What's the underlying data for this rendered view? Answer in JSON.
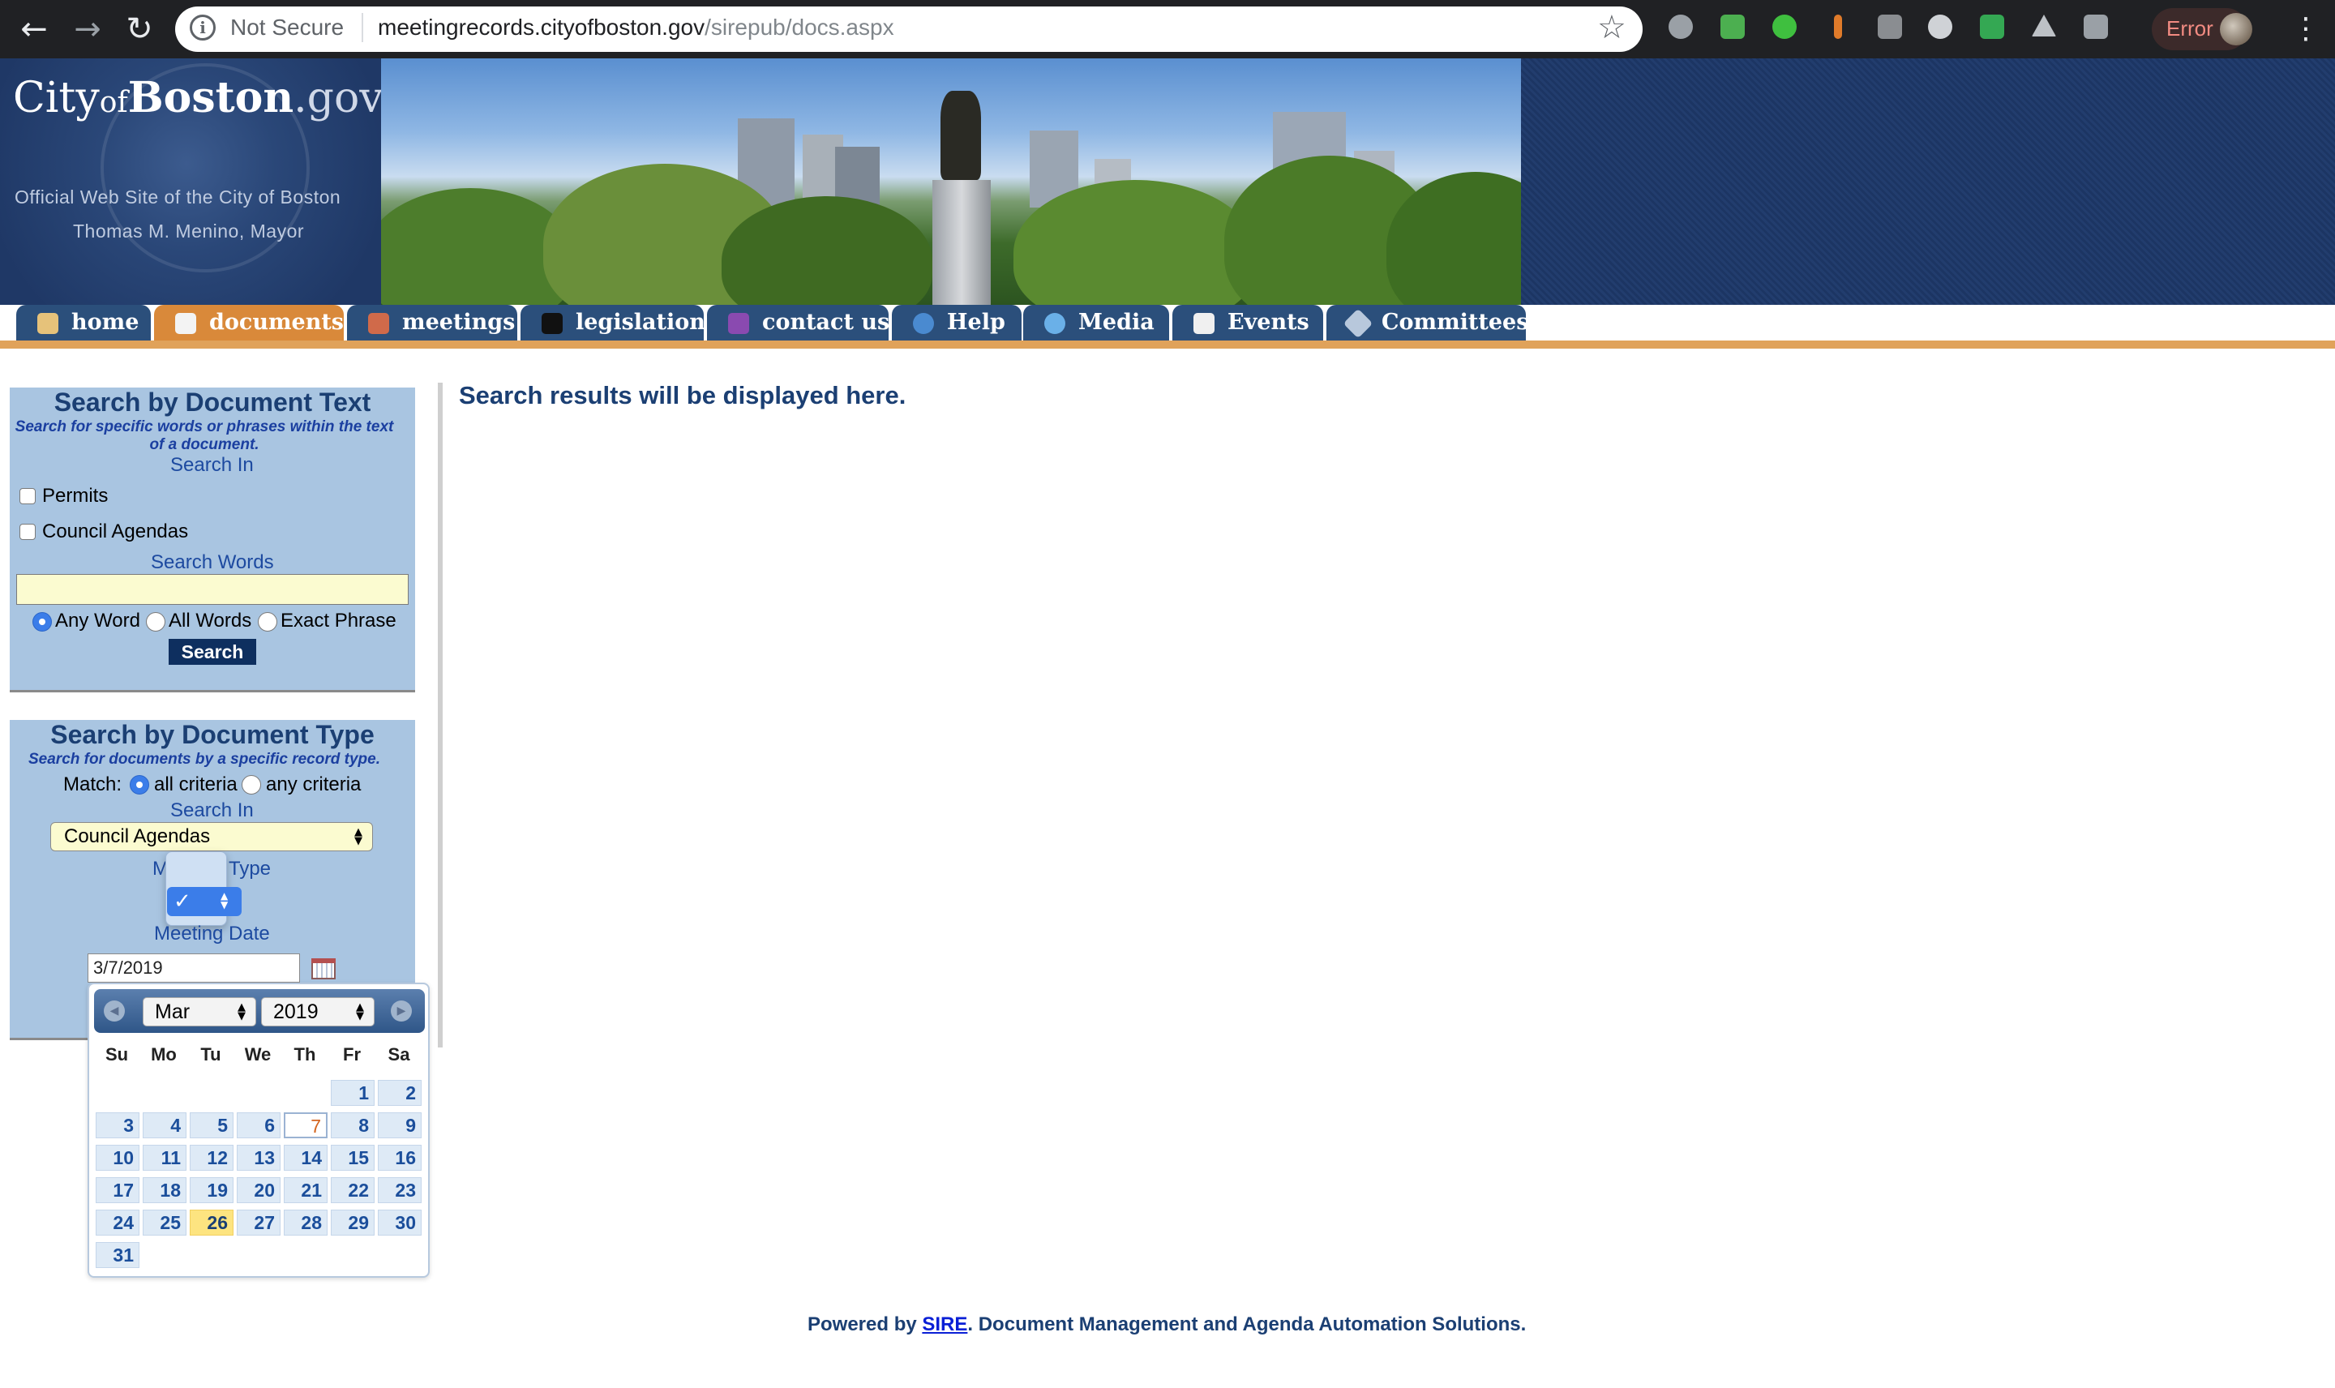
{
  "browser": {
    "security_label": "Not Secure",
    "url_host": "meetingrecords.cityofboston.gov",
    "url_path": "/sirepub/docs.aspx",
    "profile_status": "Error"
  },
  "banner": {
    "logo_city": "City",
    "logo_of": "of",
    "logo_name": "Boston",
    "logo_gov": ".gov",
    "tagline": "Official Web Site of the City of Boston",
    "mayor": "Thomas M. Menino, Mayor"
  },
  "nav": {
    "tabs": [
      {
        "label": "home",
        "icon": "house-icon"
      },
      {
        "label": "documents",
        "icon": "document-search-icon",
        "active": true
      },
      {
        "label": "meetings",
        "icon": "people-icon"
      },
      {
        "label": "legislation",
        "icon": "gavel-icon"
      },
      {
        "label": "contact us",
        "icon": "book-icon"
      },
      {
        "label": "Help",
        "icon": "help-icon"
      },
      {
        "label": "Media",
        "icon": "globe-icon"
      },
      {
        "label": "Events",
        "icon": "calendar-icon"
      },
      {
        "label": "Committees",
        "icon": "committee-icon"
      }
    ],
    "accent_color": "#d9893a",
    "tab_color": "#2b4f7b"
  },
  "text_search": {
    "title": "Search by Document Text",
    "subtitle": "Search for specific words or phrases within the text of a document.",
    "search_in_label": "Search In",
    "options": [
      "Permits",
      "Council Agendas"
    ],
    "search_words_label": "Search Words",
    "search_words_value": "",
    "modes": [
      "Any Word",
      "All Words",
      "Exact Phrase"
    ],
    "selected_mode": "Any Word",
    "search_button": "Search"
  },
  "type_search": {
    "title": "Search by Document Type",
    "subtitle": "Search for documents by a specific record type.",
    "match_label": "Match:",
    "match_options": [
      "all criteria",
      "any criteria"
    ],
    "selected_match": "all criteria",
    "search_in_label": "Search In",
    "search_in_value": "Council Agendas",
    "meeting_type_label_left": "M",
    "meeting_type_label_right": "Type",
    "meeting_type_popup_check": "✓",
    "meeting_date_label": "Meeting Date",
    "meeting_date_value": "3/7/2019"
  },
  "calendar": {
    "month": "Mar",
    "year": "2019",
    "weekdays": [
      "Su",
      "Mo",
      "Tu",
      "We",
      "Th",
      "Fr",
      "Sa"
    ],
    "days": [
      "1",
      "2",
      "3",
      "4",
      "5",
      "6",
      "7",
      "8",
      "9",
      "10",
      "11",
      "12",
      "13",
      "14",
      "15",
      "16",
      "17",
      "18",
      "19",
      "20",
      "21",
      "22",
      "23",
      "24",
      "25",
      "26",
      "27",
      "28",
      "29",
      "30",
      "31"
    ],
    "selected_day": "7",
    "highlighted_day": "26",
    "prev_icon": "arrow-left-icon",
    "next_icon": "arrow-right-icon"
  },
  "main": {
    "results_placeholder": "Search results will be displayed here."
  },
  "footer": {
    "prefix": "Powered by ",
    "link": "SIRE",
    "suffix": ". Document Management and Agenda Automation Solutions."
  }
}
